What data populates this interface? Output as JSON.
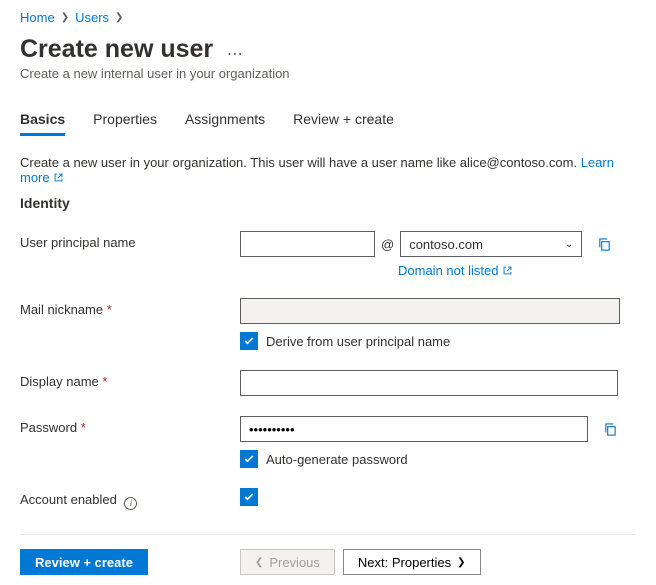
{
  "breadcrumb": {
    "home": "Home",
    "users": "Users"
  },
  "header": {
    "title": "Create new user",
    "subtitle": "Create a new internal user in your organization"
  },
  "tabs": {
    "basics": "Basics",
    "properties": "Properties",
    "assignments": "Assignments",
    "review": "Review + create"
  },
  "description": {
    "text": "Create a new user in your organization. This user will have a user name like alice@contoso.com.",
    "learn_more": "Learn more"
  },
  "identity": {
    "heading": "Identity",
    "upn_label": "User principal name",
    "upn_value": "",
    "at": "@",
    "domain_value": "contoso.com",
    "domain_not_listed": "Domain not listed",
    "mail_label": "Mail nickname",
    "mail_value": "",
    "derive_label": "Derive from user principal name",
    "display_label": "Display name",
    "display_value": "",
    "password_label": "Password",
    "password_value": "••••••••••",
    "autogen_label": "Auto-generate password",
    "account_enabled_label": "Account enabled"
  },
  "footer": {
    "review": "Review + create",
    "previous": "Previous",
    "next": "Next: Properties"
  }
}
